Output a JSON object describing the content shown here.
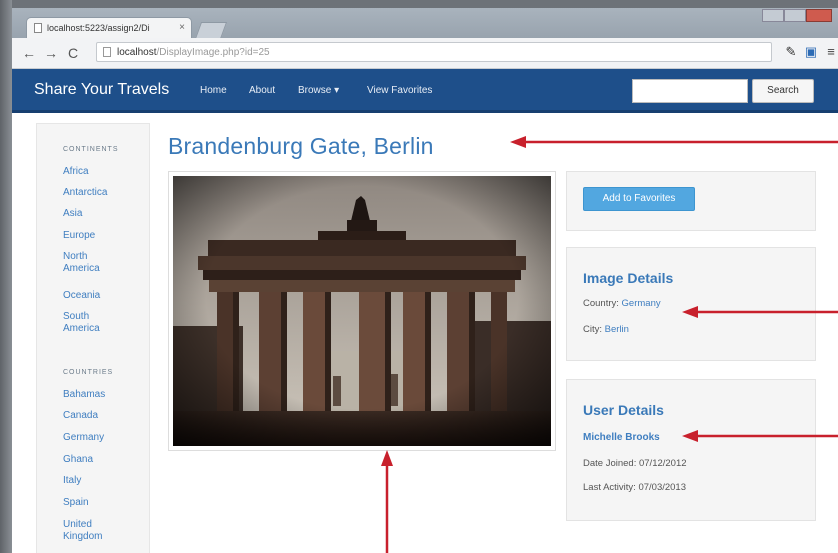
{
  "browser": {
    "tab_title": "localhost:5223/assign2/Di",
    "tab_close": "×",
    "url_host": "localhost",
    "url_path": "/DisplayImage.php?id=25",
    "icons": [
      "back-arrow-icon",
      "forward-arrow-icon",
      "reload-icon",
      "wrench-icon",
      "bookmark-icon",
      "menu-icon"
    ]
  },
  "nav": {
    "brand": "Share Your Travels",
    "links": [
      "Home",
      "About",
      "Browse ▾",
      "View Favorites"
    ],
    "search_button": "Search",
    "search_value": ""
  },
  "sidebar": {
    "continents_heading": "CONTINENTS",
    "continents": [
      "Africa",
      "Antarctica",
      "Asia",
      "Europe",
      "North America",
      "Oceania",
      "South America"
    ],
    "countries_heading": "COUNTRIES",
    "countries": [
      "Bahamas",
      "Canada",
      "Germany",
      "Ghana",
      "Italy",
      "Spain",
      "United Kingdom"
    ]
  },
  "main": {
    "title": "Brandenburg Gate, Berlin",
    "add_favorites": "Add to Favorites",
    "image_details": {
      "heading": "Image Details",
      "country_label": "Country:",
      "country_value": "Germany",
      "city_label": "City:",
      "city_value": "Berlin"
    },
    "user_details": {
      "heading": "User Details",
      "name": "Michelle Brooks",
      "joined_label": "Date Joined:",
      "joined_value": "07/12/2012",
      "activity_label": "Last Activity:",
      "activity_value": "07/03/2013"
    }
  },
  "colors": {
    "navbar": "#1e4f8a",
    "accent": "#3a79b8",
    "link": "#3f7ec0",
    "button": "#52a7e0",
    "annotation_arrow": "#c8202c"
  }
}
